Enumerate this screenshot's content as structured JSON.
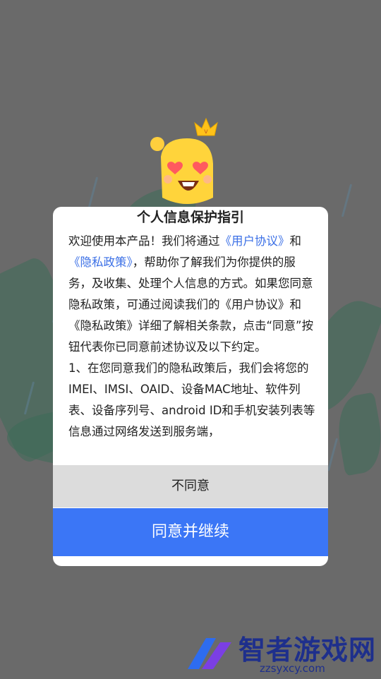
{
  "dialog": {
    "title": "个人信息保护指引",
    "paragraph1": {
      "intro": "欢迎使用本产品！我们将通过",
      "user_agreement_link": "《用户协议》",
      "and": "和",
      "privacy_policy_link": "《隐私政策》",
      "rest": "，帮助你了解我们为你提供的服务，及收集、处理个人信息的方式。如果您同意隐私政策，可通过阅读我们的《用户协议》和《隐私政策》详细了解相关条款，点击“同意”按钮代表你已同意前述协议及以下约定。"
    },
    "paragraph2": "1、在您同意我们的隐私政策后，我们会将您的IMEI、IMSI、OAID、设备MAC地址、软件列表、设备序列号、android ID和手机安装列表等信息通过网络发送到服务端，",
    "disagree_label": "不同意",
    "agree_label": "同意并继续"
  },
  "watermark": {
    "text": "智者游戏网",
    "url": "zzsyxcy.com"
  },
  "colors": {
    "link": "#3a6fe6",
    "agree_button": "#3b76f6",
    "disagree_button": "#dcdcdc"
  },
  "icons": {
    "mascot": "crowned-emoji-mascot-icon",
    "watermark_logo": "zhizhe-logo-icon"
  }
}
